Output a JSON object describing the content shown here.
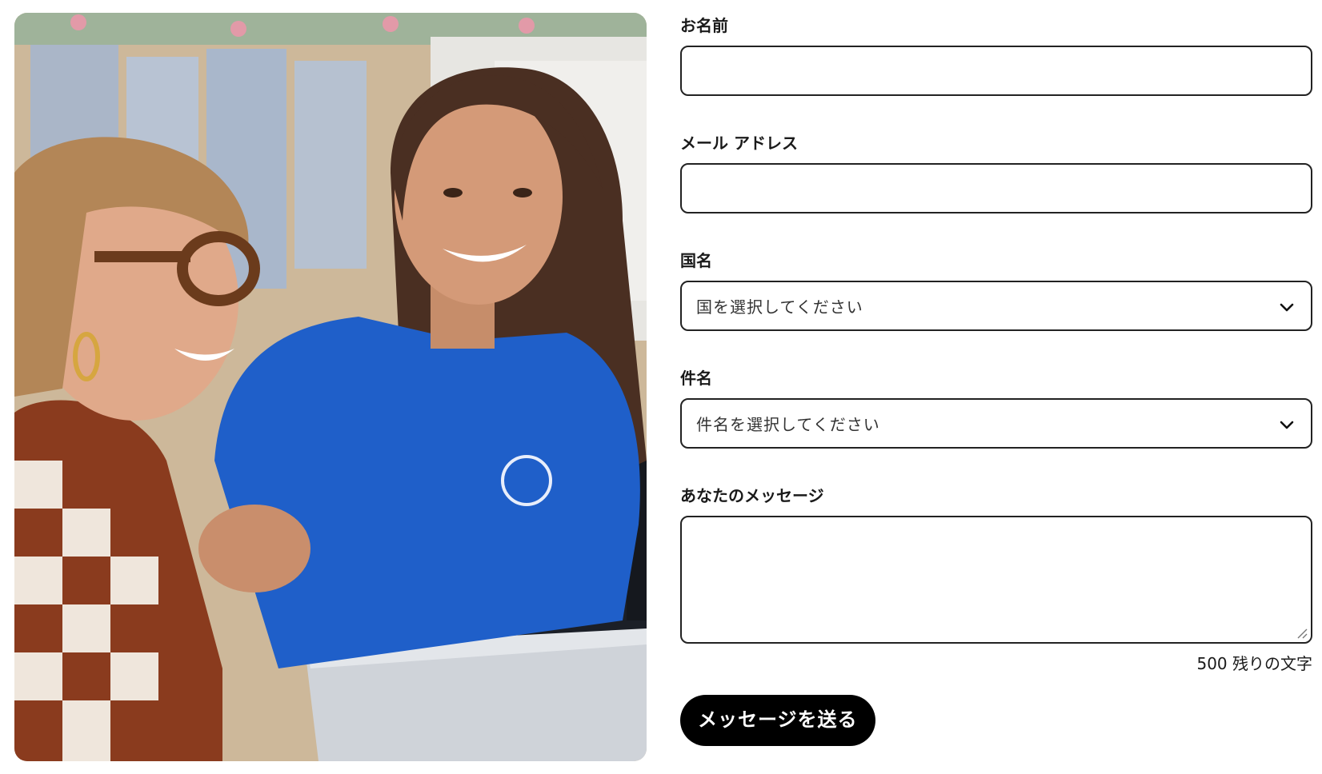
{
  "form": {
    "name_label": "お名前",
    "name_value": "",
    "email_label": "メール アドレス",
    "email_value": "",
    "country_label": "国名",
    "country_selected": "国を選択してください",
    "subject_label": "件名",
    "subject_selected": "件名を選択してください",
    "message_label": "あなたのメッセージ",
    "message_value": "",
    "char_counter": "500 残りの文字",
    "submit_label": "メッセージを送る"
  },
  "icons": {
    "select_chevron": "chevron-down-icon",
    "textarea_resize": "resize-grip-icon"
  },
  "colors": {
    "button_bg": "#000000",
    "button_text": "#ffffff",
    "border": "#222222",
    "shirt_blue": "#1f5fc9"
  }
}
